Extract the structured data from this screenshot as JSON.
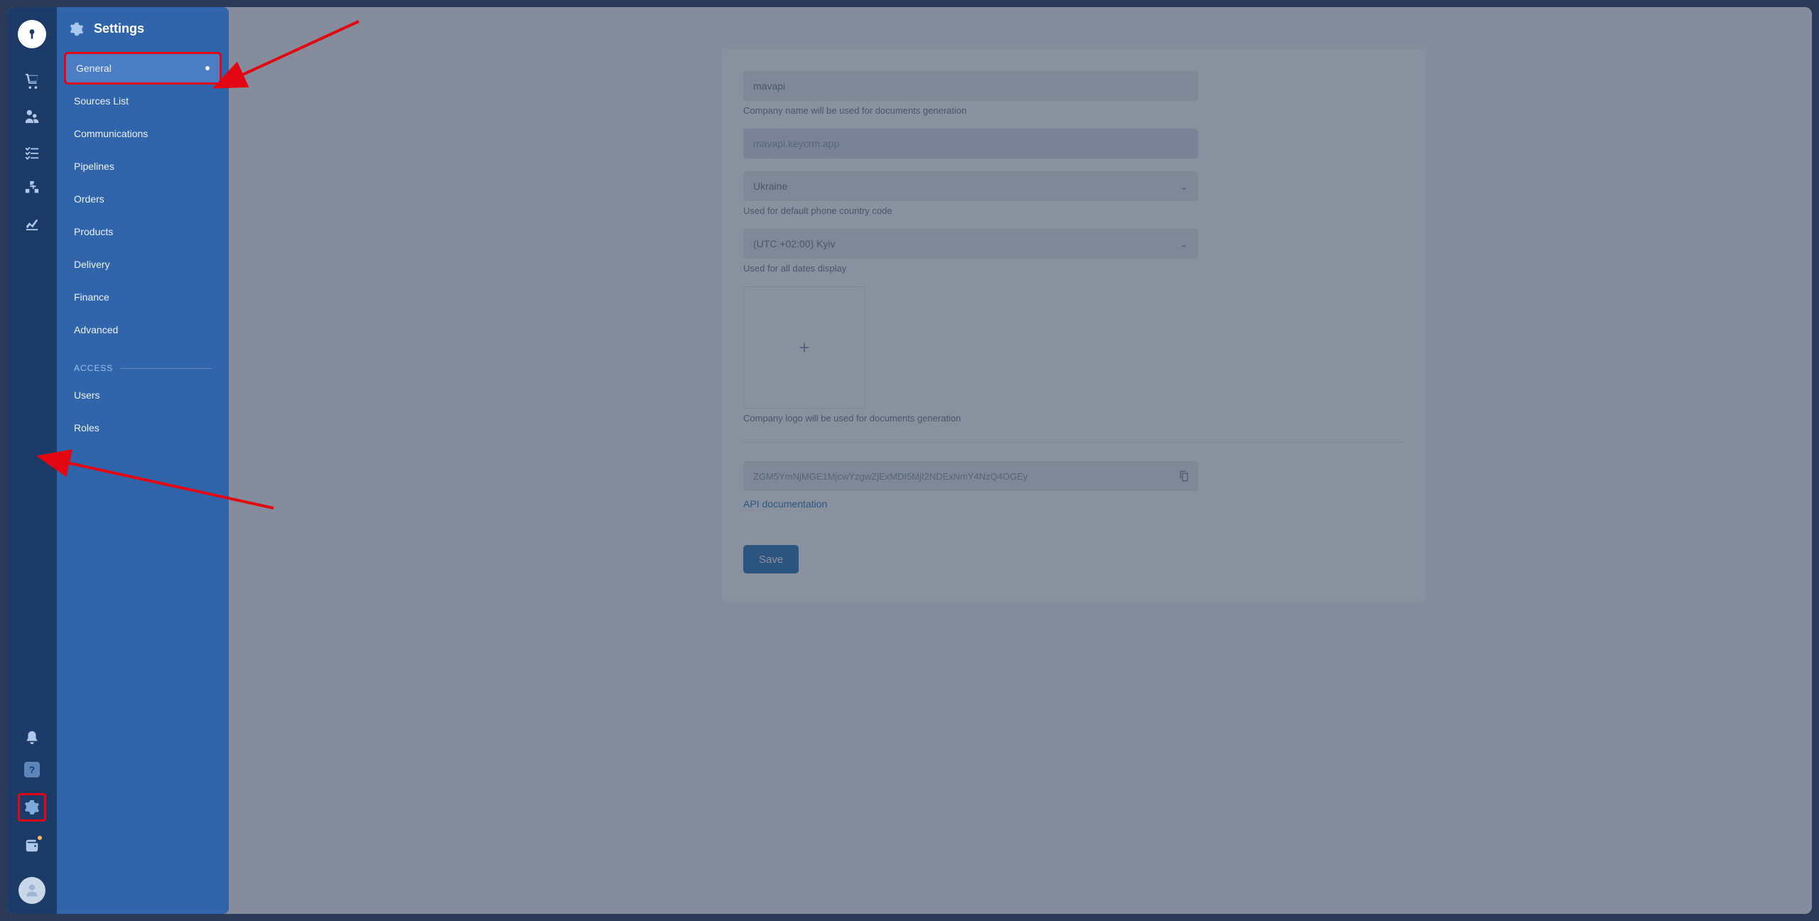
{
  "settings": {
    "title": "Settings",
    "items": {
      "general": "General",
      "sources": "Sources List",
      "communications": "Communications",
      "pipelines": "Pipelines",
      "orders": "Orders",
      "products": "Products",
      "delivery": "Delivery",
      "finance": "Finance",
      "advanced": "Advanced"
    },
    "section_access": "ACCESS",
    "access": {
      "users": "Users",
      "roles": "Roles"
    }
  },
  "form": {
    "company_name": "mavapi",
    "company_hint": "Company name will be used for documents generation",
    "domain": "mavapi.keycrm.app",
    "country": "Ukraine",
    "country_hint": "Used for default phone country code",
    "timezone": "(UTC +02:00) Kyiv",
    "timezone_hint": "Used for all dates display",
    "logo_hint": "Company logo will be used for documents generation",
    "api_key": "ZGM5YmNjMGE1MjcwYzgwZjExMDI5MjI2NDExNmY4NzQ4OGEy",
    "api_doc": "API documentation",
    "save": "Save"
  },
  "icons": {
    "logo": "keyhole-icon",
    "cart": "cart-icon",
    "people": "people-chat-icon",
    "tasks": "checklist-icon",
    "blocks": "inventory-icon",
    "analytics": "analytics-icon",
    "bell": "bell-icon",
    "help": "help-icon",
    "gear": "gear-icon",
    "wallet": "wallet-icon",
    "avatar": "avatar-icon"
  }
}
